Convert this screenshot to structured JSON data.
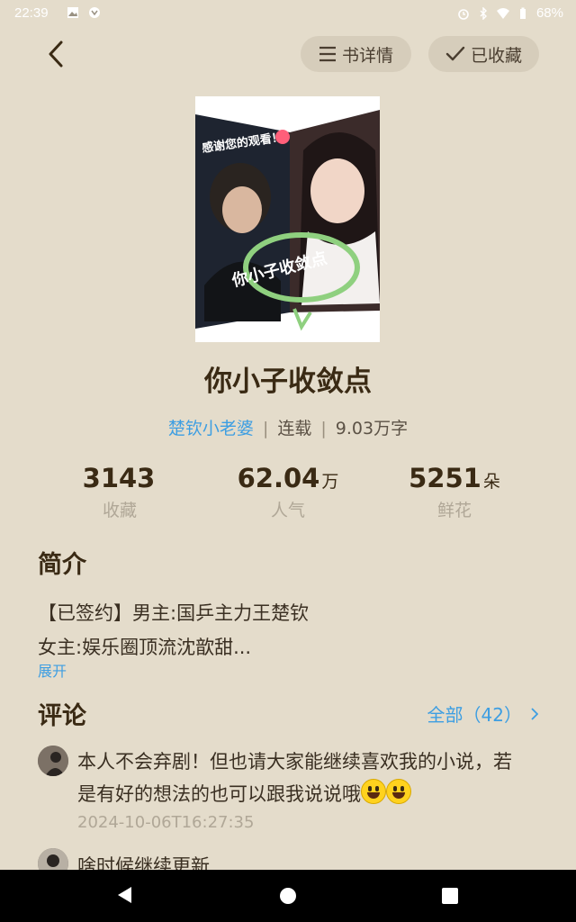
{
  "status_bar": {
    "time": "22:39",
    "battery": "68%"
  },
  "header": {
    "details_label": "书详情",
    "favorited_label": "已收藏"
  },
  "book": {
    "title": "你小子收敛点",
    "author": "楚钦小老婆",
    "status": "连载",
    "word_count": "9.03万字",
    "cover_text_top": "感谢您的观看！",
    "cover_text_circle": "你小子收敛点"
  },
  "stats": [
    {
      "value": "3143",
      "unit": "",
      "label": "收藏"
    },
    {
      "value": "62.04",
      "unit": "万",
      "label": "人气"
    },
    {
      "value": "5251",
      "unit": "朵",
      "label": "鲜花"
    }
  ],
  "intro": {
    "heading": "简介",
    "line1": "【已签约】男主:国乒主力王楚钦",
    "line2": "女主:娱乐圈顶流沈歆甜...",
    "expand_label": "展开"
  },
  "comments": {
    "heading": "评论",
    "all_label": "全部（42）",
    "items": [
      {
        "text": "本人不会弃剧！但也请大家能继续喜欢我的小说，若是有好的想法的也可以跟我说说哦",
        "time": "2024-10-06T16:27:35"
      },
      {
        "text": "啥时候继续更新"
      }
    ]
  },
  "colors": {
    "background": "#e4dccb",
    "accent": "#3d9ee2",
    "title": "#3a2a14",
    "muted": "#b0a797"
  }
}
